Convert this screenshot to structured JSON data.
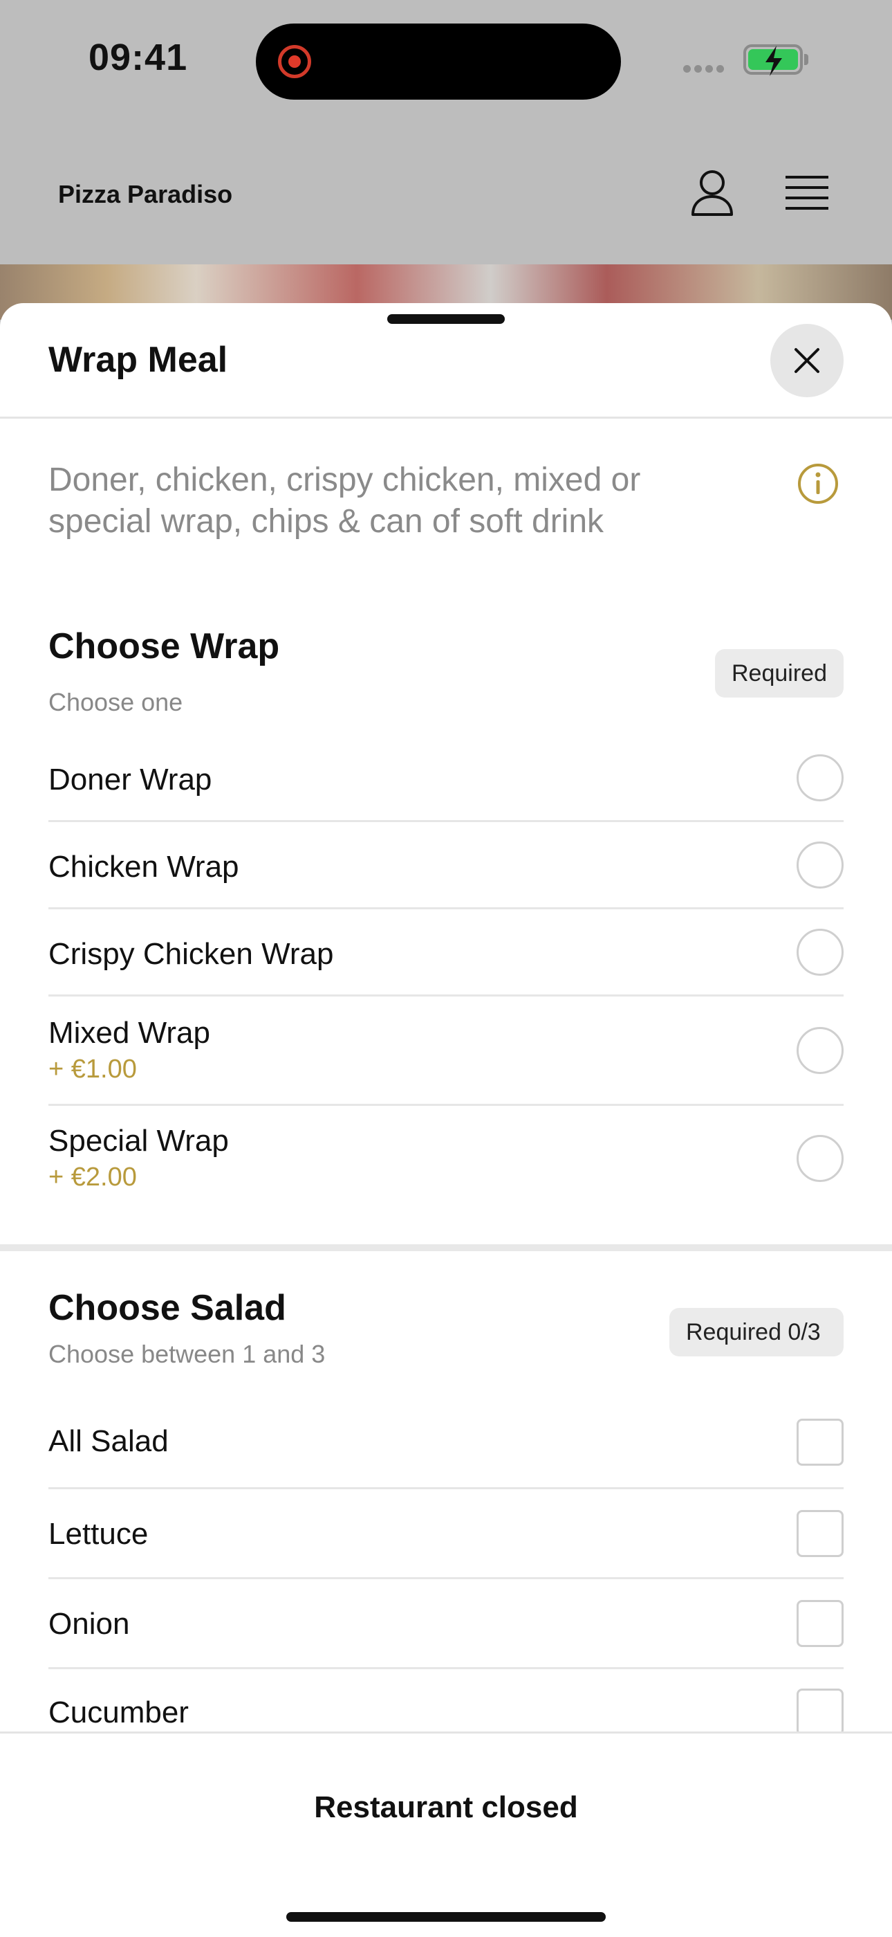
{
  "status_bar": {
    "time": "09:41"
  },
  "header": {
    "restaurant_name": "Pizza Paradiso"
  },
  "sheet": {
    "title": "Wrap Meal",
    "description": "Doner, chicken, crispy chicken, mixed or special wrap, chips & can of soft drink",
    "sections": [
      {
        "title": "Choose Wrap",
        "subtitle": "Choose one",
        "badge": "Required",
        "options": [
          {
            "label": "Doner Wrap",
            "price": ""
          },
          {
            "label": "Chicken Wrap",
            "price": ""
          },
          {
            "label": "Crispy Chicken Wrap",
            "price": ""
          },
          {
            "label": "Mixed Wrap",
            "price": "+ €1.00"
          },
          {
            "label": "Special Wrap",
            "price": "+ €2.00"
          }
        ]
      },
      {
        "title": "Choose Salad",
        "subtitle": "Choose between 1 and 3",
        "badge": "Required 0/3",
        "options": [
          {
            "label": "All Salad"
          },
          {
            "label": "Lettuce"
          },
          {
            "label": "Onion"
          },
          {
            "label": "Cucumber"
          }
        ]
      }
    ]
  },
  "footer": {
    "status_label": "Restaurant closed"
  },
  "colors": {
    "accent_price": "#b89a3c",
    "battery_green": "#34c759",
    "record_red": "#e03a2a"
  },
  "icons": [
    "record-icon",
    "battery-icon",
    "profile-icon",
    "menu-icon",
    "close-icon",
    "info-icon"
  ]
}
